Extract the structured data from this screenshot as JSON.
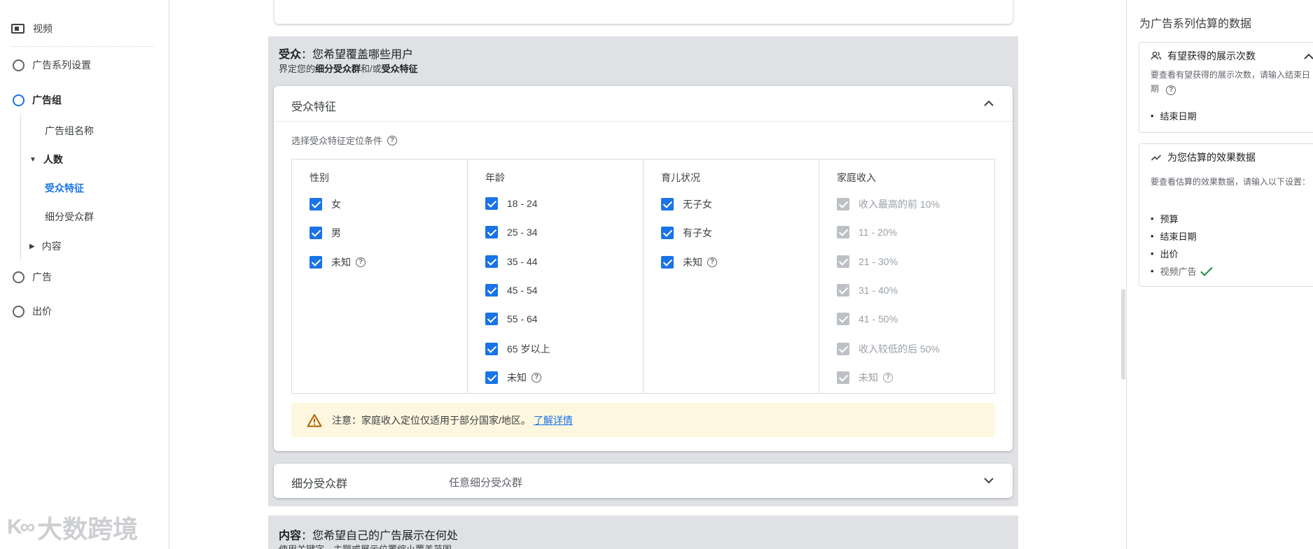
{
  "nav": {
    "video": "视频",
    "campaign_settings": "广告系列设置",
    "ad_group": "广告组",
    "ad_group_name": "广告组名称",
    "people": "人数",
    "demographics": "受众特征",
    "audience_segments": "细分受众群",
    "content": "内容",
    "ads": "广告",
    "bidding": "出价"
  },
  "watermark": {
    "logo": "K∞",
    "text": "大数跨境"
  },
  "audience": {
    "title_bold": "受众",
    "title_rest": "：您希望覆盖哪些用户",
    "subtitle_pre": "界定您的",
    "subtitle_b1": "细分受众群",
    "subtitle_mid": "和/或",
    "subtitle_b2": "受众特征",
    "demographics_card": {
      "title": "受众特征",
      "criteria_label": "选择受众特征定位条件",
      "columns": [
        {
          "header": "性别",
          "options": [
            {
              "label": "女",
              "checked": true
            },
            {
              "label": "男",
              "checked": true
            },
            {
              "label": "未知",
              "checked": true,
              "help": true
            }
          ]
        },
        {
          "header": "年龄",
          "options": [
            {
              "label": "18 - 24",
              "checked": true
            },
            {
              "label": "25 - 34",
              "checked": true
            },
            {
              "label": "35 - 44",
              "checked": true
            },
            {
              "label": "45 - 54",
              "checked": true
            },
            {
              "label": "55 - 64",
              "checked": true
            },
            {
              "label": "65 岁以上",
              "checked": true
            },
            {
              "label": "未知",
              "checked": true,
              "help": true
            }
          ]
        },
        {
          "header": "育儿状况",
          "options": [
            {
              "label": "无子女",
              "checked": true
            },
            {
              "label": "有子女",
              "checked": true
            },
            {
              "label": "未知",
              "checked": true,
              "help": true
            }
          ]
        },
        {
          "header": "家庭收入",
          "disabled": true,
          "options": [
            {
              "label": "收入最高的前 10%",
              "checked": true
            },
            {
              "label": "11 - 20%",
              "checked": true
            },
            {
              "label": "21 - 30%",
              "checked": true
            },
            {
              "label": "31 - 40%",
              "checked": true
            },
            {
              "label": "41 - 50%",
              "checked": true
            },
            {
              "label": "收入较低的后 50%",
              "checked": true
            },
            {
              "label": "未知",
              "checked": true,
              "help": true
            }
          ]
        }
      ],
      "notice_text": "注意：家庭收入定位仅适用于部分国家/地区。",
      "notice_link": "了解详情"
    },
    "segments_card": {
      "title": "细分受众群",
      "value": "任意细分受众群"
    }
  },
  "content_section": {
    "title_bold": "内容",
    "title_rest": "：您希望自己的广告展示在何处",
    "subtitle": "使用关键字、主题或展示位置缩小覆盖范围"
  },
  "right_panel": {
    "title": "为广告系列估算的数据",
    "impressions": {
      "title": "有望获得的展示次数",
      "desc": "要查看有望获得的展示次数，请输入结束日期",
      "items": [
        "结束日期"
      ]
    },
    "performance": {
      "title": "为您估算的效果数据",
      "desc": "要查看估算的效果数据，请输入以下设置：",
      "items": [
        "预算",
        "结束日期",
        "出价"
      ],
      "done_item": "视频广告"
    }
  },
  "colors": {
    "accent": "#1a73e8",
    "disabled": "#bdc1c6",
    "section_bg": "#dfe1e5",
    "notice_bg": "#fef7e0",
    "success": "#1e8e3e"
  }
}
